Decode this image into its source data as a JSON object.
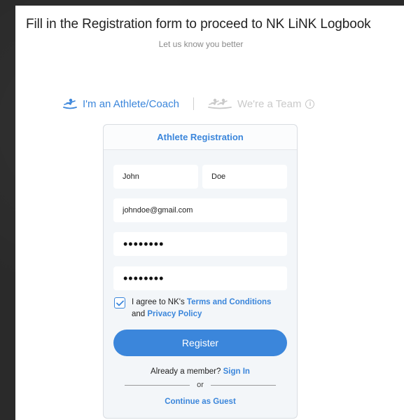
{
  "page": {
    "title": "Fill in the Registration form to proceed to NK LiNK Logbook",
    "subtitle": "Let us know you better"
  },
  "account_type": {
    "options": [
      {
        "label": "I'm an Athlete/Coach",
        "active": true,
        "icon": "single-rower-icon"
      },
      {
        "label": "We're a Team",
        "active": false,
        "icon": "team-rowers-icon"
      }
    ],
    "info_glyph": "i"
  },
  "form": {
    "header": "Athlete Registration",
    "first_name": "John",
    "last_name": "Doe",
    "email": "johndoe@gmail.com",
    "password": "••••••••",
    "confirm_password": "••••••••",
    "agree": {
      "checked": true,
      "prefix": "I agree to NK's ",
      "terms_link": "Terms and Conditions",
      "middle": "and ",
      "privacy_link": "Privacy Policy"
    },
    "register_label": "Register",
    "member_prefix": "Already a member? ",
    "sign_in_link": "Sign In",
    "or_label": "or",
    "guest_link": "Continue as Guest"
  },
  "colors": {
    "accent": "#3b86db",
    "background": "#2b2b2b",
    "card": "#f3f6f9"
  }
}
